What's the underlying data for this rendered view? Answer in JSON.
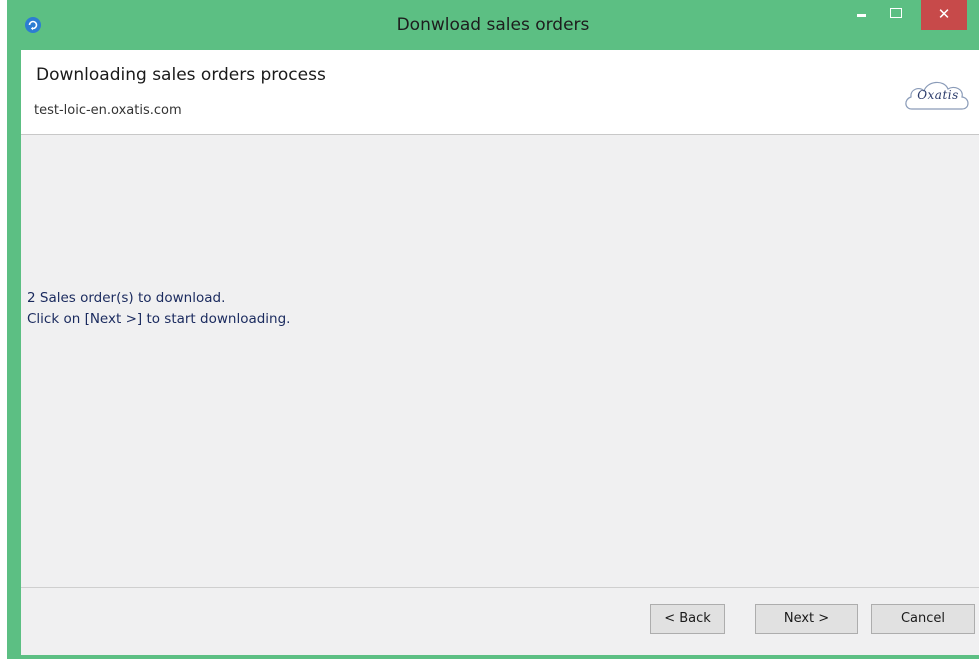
{
  "window": {
    "title": "Donwload sales orders",
    "controls": {
      "minimize": "–",
      "maximize": "□",
      "close": "✕"
    }
  },
  "header": {
    "title": "Downloading sales orders process",
    "subtitle": "test-loic-en.oxatis.com",
    "logo_text": "Oxatis"
  },
  "content": {
    "line1": "2 Sales order(s) to download.",
    "line2": "Click on [Next >] to start downloading."
  },
  "buttons": {
    "back": "< Back",
    "next": "Next >",
    "cancel": "Cancel"
  },
  "colors": {
    "title_bar": "#5cbf83",
    "close_button": "#c74a4a",
    "body_background": "#f0f0f1",
    "body_text": "#1a2a5e"
  },
  "icons": {
    "app": "refresh-icon",
    "logo": "cloud-logo-icon"
  }
}
